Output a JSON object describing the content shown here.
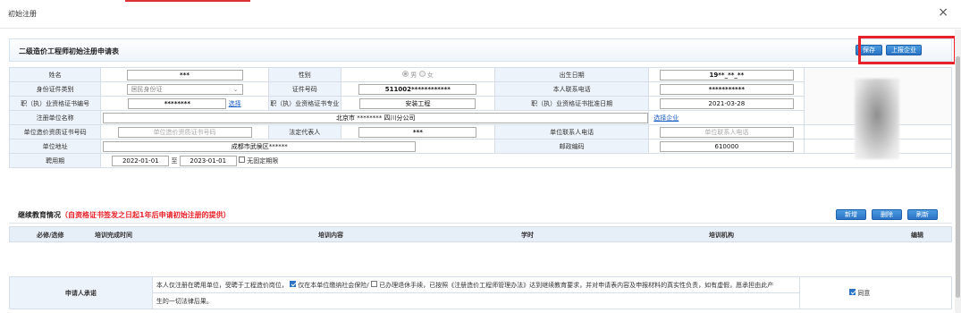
{
  "dialog": {
    "title": "初始注册",
    "close_icon": "×"
  },
  "header": {
    "title": "二级造价工程师初始注册申请表",
    "save_label": "保存",
    "report_label": "上报企业"
  },
  "form": {
    "name_label": "姓名",
    "name_value": "***",
    "gender_label": "性别",
    "gender_male": "男",
    "gender_female": "女",
    "gender_selected": "男",
    "birth_label": "出生日期",
    "birth_value": "19**_**_**",
    "id_type_label": "身份证件类别",
    "id_type_value": "居民身份证",
    "id_no_label": "证件号码",
    "id_no_value": "511002************",
    "phone_label": "本人联系电话",
    "phone_value": "***********",
    "cert_no_label": "职（执）业资格证书编号",
    "cert_no_value": "********",
    "cert_select_label": "选择",
    "major_label": "职（执）业资格证书专业",
    "major_value": "安装工程",
    "approve_date_label": "职（执）业资格证书批准日期",
    "approve_date_value": "2021-03-28",
    "unit_label": "注册单位名称",
    "unit_value": "北京市 ******** 四川分公司",
    "unit_select_label": "选择企业",
    "unit_cert_label": "单位造价资质证书号码",
    "unit_cert_placeholder": "单位造价资质证书号码",
    "legal_rep_label": "法定代表人",
    "legal_rep_value": "***",
    "unit_phone_label": "单位联系人电话",
    "unit_phone_placeholder": "单位联系人电话",
    "address_label": "单位地址",
    "address_value": "成都市武侯区******",
    "postcode_label": "邮政编码",
    "postcode_value": "610000",
    "period_label": "聘用期",
    "period_start": "2022-01-01",
    "period_to": "至",
    "period_end": "2023-01-01",
    "no_fixed_label": "无固定期限"
  },
  "continuing_education": {
    "title": "继续教育情况",
    "note": "（自资格证书签发之日起1年后申请初始注册的提供）",
    "add_label": "新增",
    "delete_label": "删除",
    "refresh_label": "刷新",
    "columns": [
      "必修/选修",
      "培训完成时间",
      "培训内容",
      "学时",
      "培训机构",
      "编辑"
    ]
  },
  "promise": {
    "label": "申请人承诺",
    "text1": "本人仅注册在聘用单位，受聘于工程造价岗位，",
    "text2": "仅在本单位缴纳社会保险/",
    "text3": "已办理退休手续，已按照《注册造价工程师管理办法》达到继续教育要求，并对申请表内容及申报材料的真实性负责，如有虚假，愿承担由此产",
    "text4": "生的一切法律后果。",
    "agree_label": "同意"
  },
  "colors": {
    "accent": "#2b73c4",
    "highlight": "#e8222a",
    "label_bg": "#edf3fa"
  }
}
